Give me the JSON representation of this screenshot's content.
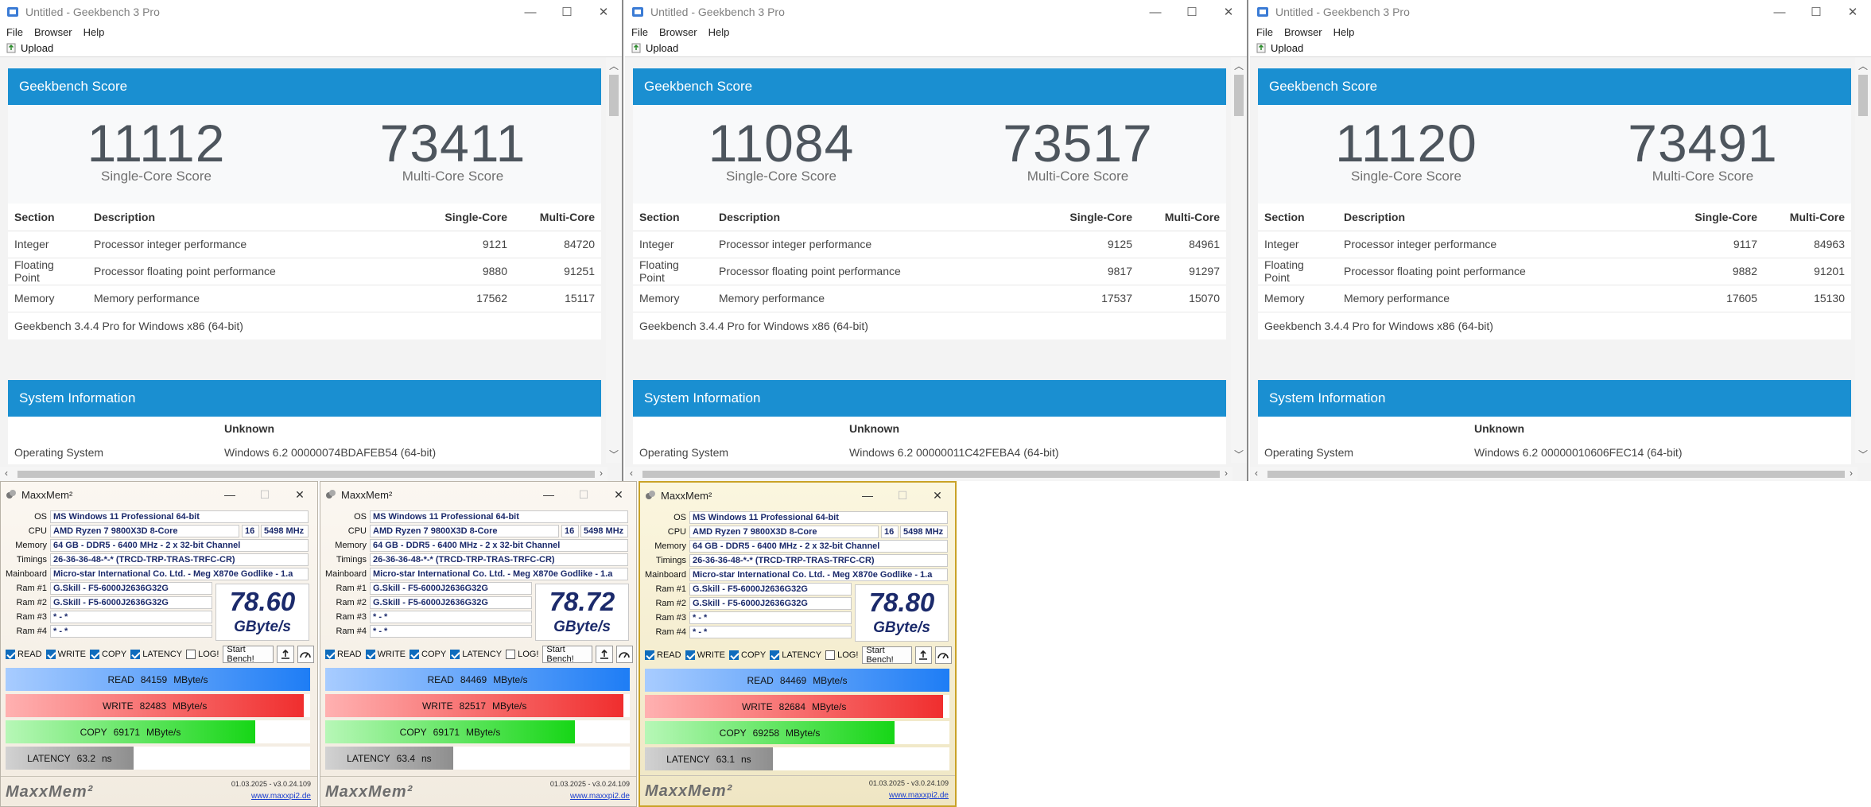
{
  "geekbench_common": {
    "title": "Untitled - Geekbench 3 Pro",
    "menu": [
      "File",
      "Browser",
      "Help"
    ],
    "upload_label": "Upload",
    "score_header": "Geekbench Score",
    "single_label": "Single-Core Score",
    "multi_label": "Multi-Core Score",
    "col_section": "Section",
    "col_description": "Description",
    "col_single": "Single-Core",
    "col_multi": "Multi-Core",
    "version_text": "Geekbench 3.4.4 Pro for Windows x86 (64-bit)",
    "sysinfo_header": "System Information",
    "sysinfo_col": "Unknown",
    "os_label": "Operating System",
    "accent": "#1a8fd1",
    "controls": [
      "—",
      "☐",
      "✕"
    ]
  },
  "geekbench": [
    {
      "single": "11112",
      "multi": "73411",
      "rows": [
        {
          "section": "Integer",
          "description": "Processor integer performance",
          "single": "9121",
          "multi": "84720"
        },
        {
          "section": "Floating Point",
          "description": "Processor floating point performance",
          "single": "9880",
          "multi": "91251"
        },
        {
          "section": "Memory",
          "description": "Memory performance",
          "single": "17562",
          "multi": "15117"
        }
      ],
      "os_value": "Windows 6.2 00000074BDAFEB54 (64-bit)"
    },
    {
      "single": "11084",
      "multi": "73517",
      "rows": [
        {
          "section": "Integer",
          "description": "Processor integer performance",
          "single": "9125",
          "multi": "84961"
        },
        {
          "section": "Floating Point",
          "description": "Processor floating point performance",
          "single": "9817",
          "multi": "91297"
        },
        {
          "section": "Memory",
          "description": "Memory performance",
          "single": "17537",
          "multi": "15070"
        }
      ],
      "os_value": "Windows 6.2 00000011C42FEBA4 (64-bit)"
    },
    {
      "single": "11120",
      "multi": "73491",
      "rows": [
        {
          "section": "Integer",
          "description": "Processor integer performance",
          "single": "9117",
          "multi": "84963"
        },
        {
          "section": "Floating Point",
          "description": "Processor floating point performance",
          "single": "9882",
          "multi": "91201"
        },
        {
          "section": "Memory",
          "description": "Memory performance",
          "single": "17605",
          "multi": "15130"
        }
      ],
      "os_value": "Windows 6.2 00000010606FEC14 (64-bit)"
    }
  ],
  "maxxmem_common": {
    "title": "MaxxMem²",
    "labels": {
      "os": "OS",
      "cpu": "CPU",
      "memory": "Memory",
      "timings": "Timings",
      "mainboard": "Mainboard",
      "ram1": "Ram #1",
      "ram2": "Ram #2",
      "ram3": "Ram #3",
      "ram4": "Ram #4"
    },
    "os": "MS Windows 11 Professional 64-bit",
    "cpu": "AMD Ryzen 7 9800X3D 8-Core",
    "threads": "16",
    "clock": "5498 MHz",
    "memory": "64 GB - DDR5 - 6400 MHz - 2 x 32-bit Channel",
    "timings": "26-36-36-48-*-* (TRCD-TRP-TRAS-TRFC-CR)",
    "mainboard": "Micro-star International Co. Ltd. - Meg X870e Godlike - 1.a",
    "ram1": "G.Skill - F5-6000J2636G32G",
    "ram2": "G.Skill - F5-6000J2636G32G",
    "ram3": "* - *",
    "ram4": "* - *",
    "unit": "GByte/s",
    "opt_read": "READ",
    "opt_write": "WRITE",
    "opt_copy": "COPY",
    "opt_latency": "LATENCY",
    "opt_log": "LOG!",
    "start_label": "Start Bench!",
    "bar_read": "READ",
    "bar_write": "WRITE",
    "bar_copy": "COPY",
    "bar_latency": "LATENCY",
    "mbs": "MByte/s",
    "ns": "ns",
    "logo": "MaxxMem²",
    "version": "01.03.2025 - v3.0.24.109",
    "link": "www.maxxpi2.de",
    "colors": {
      "read": "#1e7df5",
      "write": "#f02e2e",
      "copy": "#16d616",
      "latency": "#8e8e8e",
      "value_text": "#1b2a6b"
    }
  },
  "maxxmem": [
    {
      "score": "78.60",
      "read": "84159",
      "write": "82483",
      "copy": "69171",
      "latency": "63.2",
      "read_fill": 1.0,
      "write_fill": 0.98,
      "copy_fill": 0.82,
      "latency_fill": 0.42
    },
    {
      "score": "78.72",
      "read": "84469",
      "write": "82517",
      "copy": "69171",
      "latency": "63.4",
      "read_fill": 1.0,
      "write_fill": 0.98,
      "copy_fill": 0.82,
      "latency_fill": 0.42
    },
    {
      "score": "78.80",
      "read": "84469",
      "write": "82684",
      "copy": "69258",
      "latency": "63.1",
      "read_fill": 1.0,
      "write_fill": 0.98,
      "copy_fill": 0.82,
      "latency_fill": 0.42
    }
  ]
}
